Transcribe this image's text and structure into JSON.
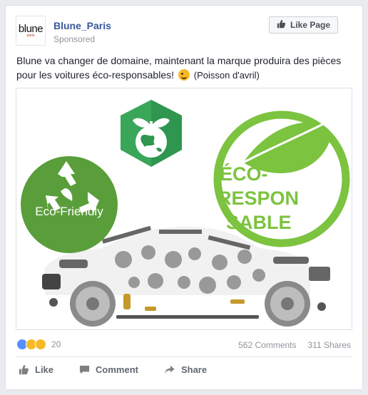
{
  "post": {
    "page_name": "Blune_Paris",
    "sponsored": "Sponsored",
    "avatar_logo": "blune",
    "avatar_logo_sub": "paris",
    "like_page_label": "Like Page",
    "text_main": "Blune va changer de domaine, maintenant la marque produira des pièces pour les voitures éco-responsables!",
    "text_suffix": "(Poisson d'avril)"
  },
  "image": {
    "badge_left": "Eco-Friendly",
    "badge_right_line1": "ÉCO-",
    "badge_right_line2": "RESPON",
    "badge_right_line3": "SABLE"
  },
  "engagement": {
    "reaction_count": "20",
    "comments": "562 Comments",
    "shares": "311 Shares"
  },
  "actions": {
    "like": "Like",
    "comment": "Comment",
    "share": "Share"
  },
  "colors": {
    "link_blue": "#365899",
    "green_dark": "#5a9e3b",
    "green_light": "#7cc33f",
    "hex_green": "#3aa65a"
  }
}
